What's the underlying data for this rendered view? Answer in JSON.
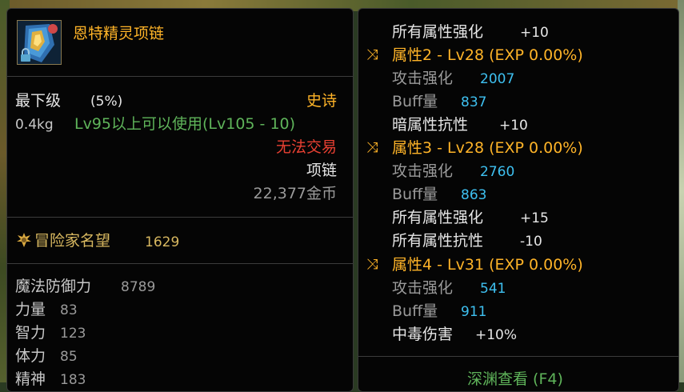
{
  "item": {
    "name": "恩特精灵项链",
    "grade": "最下级",
    "grade_pct": "(5%)",
    "rarity": "史诗",
    "weight": "0.4kg",
    "level_req": "Lv95以上可以使用(Lv105 - 10)",
    "trade": "无法交易",
    "type": "项链",
    "price": "22,377金币",
    "reputation_label": "冒险家名望",
    "reputation_value": "1629",
    "stats": [
      {
        "label": "魔法防御力",
        "value": "8789"
      },
      {
        "label": "力量",
        "value": "83"
      },
      {
        "label": "智力",
        "value": "123"
      },
      {
        "label": "体力",
        "value": "85"
      },
      {
        "label": "精神",
        "value": "183"
      }
    ]
  },
  "right": {
    "line1": {
      "label": "所有属性强化",
      "value": "+10"
    },
    "attr2": {
      "title": "属性2 - Lv28 (EXP 0.00%)",
      "atk_label": "攻击强化",
      "atk": "2007",
      "buff_label": "Buff量",
      "buff": "837"
    },
    "line_dark": {
      "label": "暗属性抗性",
      "value": "+10"
    },
    "attr3": {
      "title": "属性3 - Lv28 (EXP 0.00%)",
      "atk_label": "攻击强化",
      "atk": "2760",
      "buff_label": "Buff量",
      "buff": "863"
    },
    "line_all_str": {
      "label": "所有属性强化",
      "value": "+15"
    },
    "line_all_res": {
      "label": "所有属性抗性",
      "value": "-10"
    },
    "attr4": {
      "title": "属性4 - Lv31 (EXP 0.00%)",
      "atk_label": "攻击强化",
      "atk": "541",
      "buff_label": "Buff量",
      "buff": "911"
    },
    "poison": {
      "label": "中毒伤害",
      "value": "+10%"
    },
    "bottom_link": "深渊查看 (F4)"
  },
  "colors": {
    "rarity": "#ffb428",
    "attack_value": "#3ec0f0",
    "untradeable": "#e84032",
    "level_req": "#5fb45a"
  },
  "icons": [
    "necklace-item-icon",
    "lock-icon",
    "reputation-crest-icon",
    "shuffle-icon"
  ]
}
